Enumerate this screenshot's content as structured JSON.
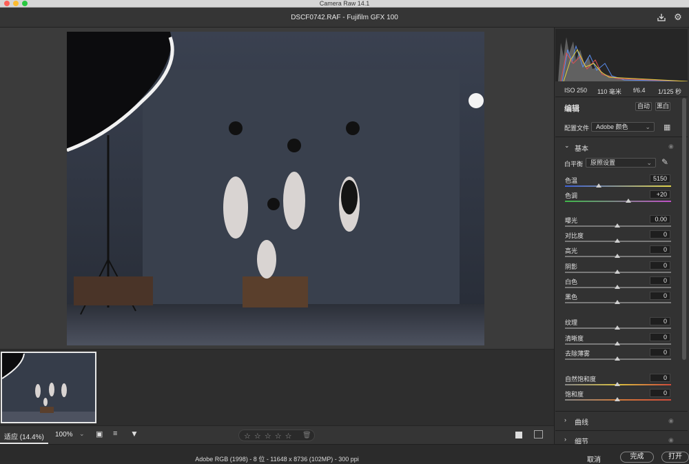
{
  "window": {
    "title": "Camera Raw 14.1"
  },
  "header": {
    "filename": "DSCF0742.RAF -  Fujifilm GFX 100",
    "save_icon": "save-icon",
    "settings_icon": "gear-icon"
  },
  "camera_info": {
    "iso": "ISO 250",
    "focal": "110 毫米",
    "aperture": "f/6.4",
    "shutter": "1/125 秒"
  },
  "edit": {
    "title": "编辑",
    "auto_label": "自动",
    "bw_label": "黑白",
    "profile_label": "配置文件",
    "profile_value": "Adobe 颜色"
  },
  "basic": {
    "title": "基本",
    "wb_label": "白平衡",
    "wb_value": "原照设置",
    "temp": {
      "label": "色温",
      "value": "5150",
      "level": 0.32
    },
    "tint": {
      "label": "色调",
      "value": "+20",
      "level": 0.6
    },
    "sliders": [
      {
        "label": "曝光",
        "value": "0.00"
      },
      {
        "label": "对比度",
        "value": "0"
      },
      {
        "label": "高光",
        "value": "0"
      },
      {
        "label": "阴影",
        "value": "0"
      },
      {
        "label": "白色",
        "value": "0"
      },
      {
        "label": "黑色",
        "value": "0"
      },
      {
        "label": "纹理",
        "value": "0"
      },
      {
        "label": "清晰度",
        "value": "0"
      },
      {
        "label": "去除薄雾",
        "value": "0"
      },
      {
        "label": "自然饱和度",
        "value": "0"
      },
      {
        "label": "饱和度",
        "value": "0"
      }
    ]
  },
  "sections": {
    "curve": "曲线",
    "detail": "细节"
  },
  "toolbar": {
    "fit_label": "适应 (14.4%)",
    "zoom_value": "100%",
    "stars": "☆ ☆ ☆ ☆ ☆"
  },
  "footer": {
    "info": "Adobe RGB (1998) - 8 位 - 11648 x 8736 (102MP) - 300 ppi",
    "cancel": "取消",
    "done": "完成",
    "open": "打开"
  }
}
